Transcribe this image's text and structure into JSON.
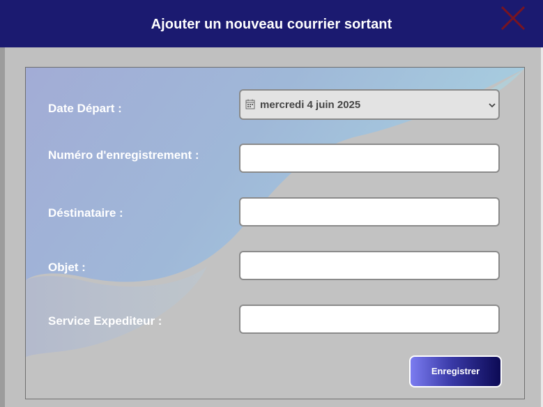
{
  "dialog": {
    "title": "Ajouter un nouveau courrier sortant",
    "close_icon": "close-x-icon",
    "title_bar_color": "#1b1a70",
    "close_color": "#7a1420"
  },
  "form": {
    "fields": [
      {
        "label": "Date Départ :",
        "type": "date",
        "value": "mercredi 4 juin 2025"
      },
      {
        "label": "Numéro d'enregistrement :",
        "type": "text",
        "value": ""
      },
      {
        "label": "Déstinataire :",
        "type": "text",
        "value": ""
      },
      {
        "label": "Objet :",
        "type": "text",
        "value": ""
      },
      {
        "label": "Service Expediteur :",
        "type": "text",
        "value": ""
      }
    ],
    "date_icon": "calendar-icon",
    "dropdown_icon": "chevron-down-icon"
  },
  "actions": {
    "save_label": "Enregistrer",
    "save_gradient": [
      "#7b7cf0",
      "#0c0a55"
    ]
  }
}
